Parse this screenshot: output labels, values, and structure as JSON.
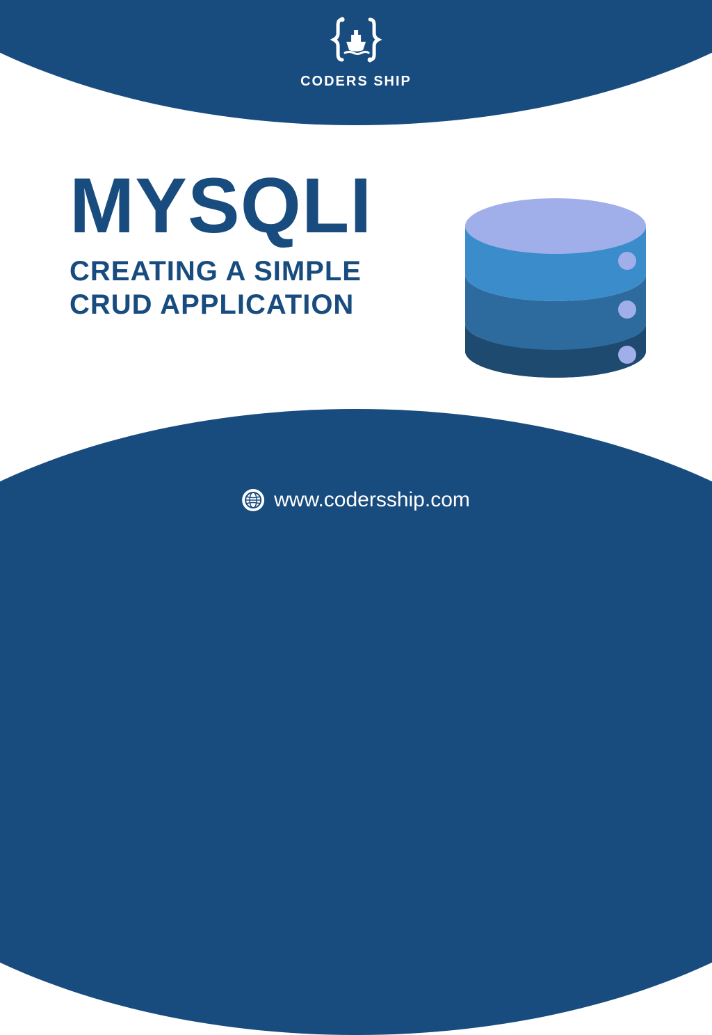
{
  "brand": {
    "name": "CODERS SHIP"
  },
  "heading": {
    "title": "MYSQLI",
    "subtitle_line1": "CREATING A SIMPLE",
    "subtitle_line2": "CRUD APPLICATION"
  },
  "footer": {
    "url": "www.codersship.com"
  },
  "colors": {
    "primary": "#184b7e",
    "db_top": "#a0aeea",
    "db_layer1": "#3a8ccb",
    "db_layer2": "#2d6b9f",
    "db_layer3": "#1e4a6f"
  }
}
